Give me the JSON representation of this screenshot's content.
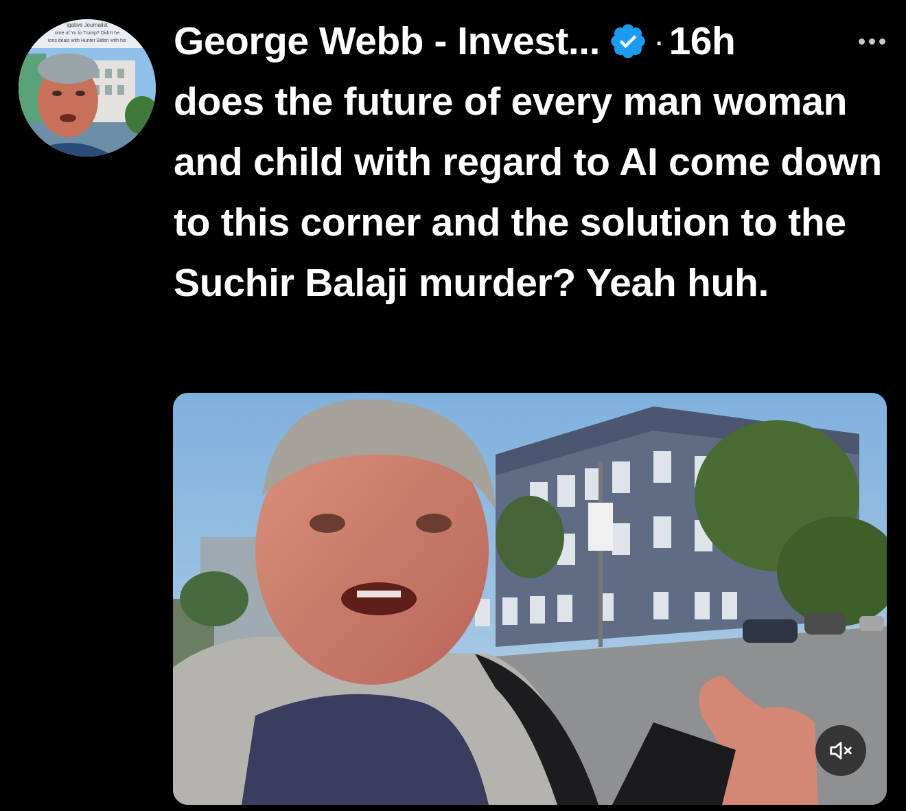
{
  "tweet": {
    "author_name": "George Webb - Invest...",
    "separator": "·",
    "time_ago": "16h",
    "text": "does the future of every man woman and child with regard to AI come down to this corner and the solution to the Suchir Balaji murder? Yeah huh.",
    "verified": true
  },
  "avatar": {
    "caption_lines": [
      "igative Journalist",
      "ome of Yu to Trump? Didn't he",
      "ions deals with Hunter Biden with his"
    ]
  },
  "icons": {
    "verified": "verified-badge-icon",
    "more": "more-options-icon",
    "mute": "volume-muted-icon"
  },
  "colors": {
    "background": "#000000",
    "text": "#ffffff",
    "verified_blue": "#1d9bf0"
  }
}
